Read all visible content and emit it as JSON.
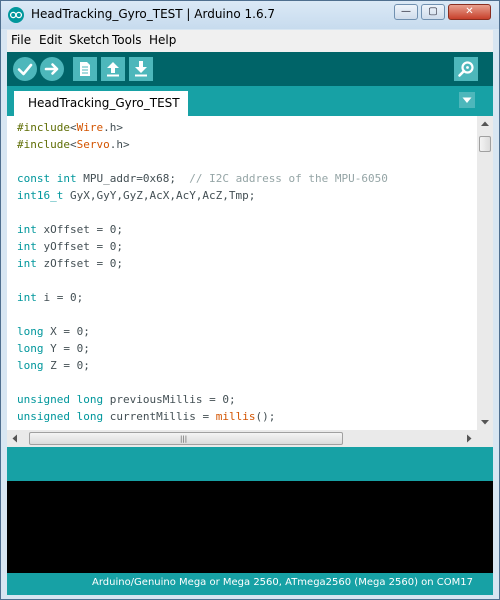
{
  "window": {
    "title": "HeadTracking_Gyro_TEST | Arduino 1.6.7",
    "controls": {
      "minimize": "—",
      "maximize": "▢",
      "close": "✕"
    }
  },
  "menu": {
    "items": [
      {
        "label": "File"
      },
      {
        "label": "Edit"
      },
      {
        "label": "Sketch"
      },
      {
        "label": "Tools"
      },
      {
        "label": "Help"
      }
    ]
  },
  "toolbar": {
    "buttons": [
      {
        "name": "verify",
        "icon": "check-icon"
      },
      {
        "name": "upload",
        "icon": "arrow-right-icon"
      },
      {
        "name": "new",
        "icon": "new-file-icon"
      },
      {
        "name": "open",
        "icon": "arrow-up-icon"
      },
      {
        "name": "save",
        "icon": "arrow-down-icon"
      }
    ],
    "serial_monitor_icon": "magnifier-icon"
  },
  "tabs": {
    "active": "HeadTracking_Gyro_TEST",
    "menu_icon": "chevron-down-icon"
  },
  "editor": {
    "lines": [
      "#include<Wire.h>",
      "#include<Servo.h>",
      "",
      "const int MPU_addr=0x68;  // I2C address of the MPU-6050",
      "int16_t GyX,GyY,GyZ,AcX,AcY,AcZ,Tmp;",
      "",
      "int xOffset = 0;",
      "int yOffset = 0;",
      "int zOffset = 0;",
      "",
      "int i = 0;",
      "",
      "long X = 0;",
      "long Y = 0;",
      "long Z = 0;",
      "",
      "unsigned long previousMillis = 0;",
      "unsigned long currentMillis = millis();"
    ]
  },
  "status": {
    "board": "Arduino/Genuino Mega or Mega 2560, ATmega2560 (Mega 2560) on COM17"
  },
  "colors": {
    "toolbar_bg": "#006468",
    "teal": "#17a1a5",
    "button_bg": "#4db7bb",
    "console_bg": "#000000"
  }
}
